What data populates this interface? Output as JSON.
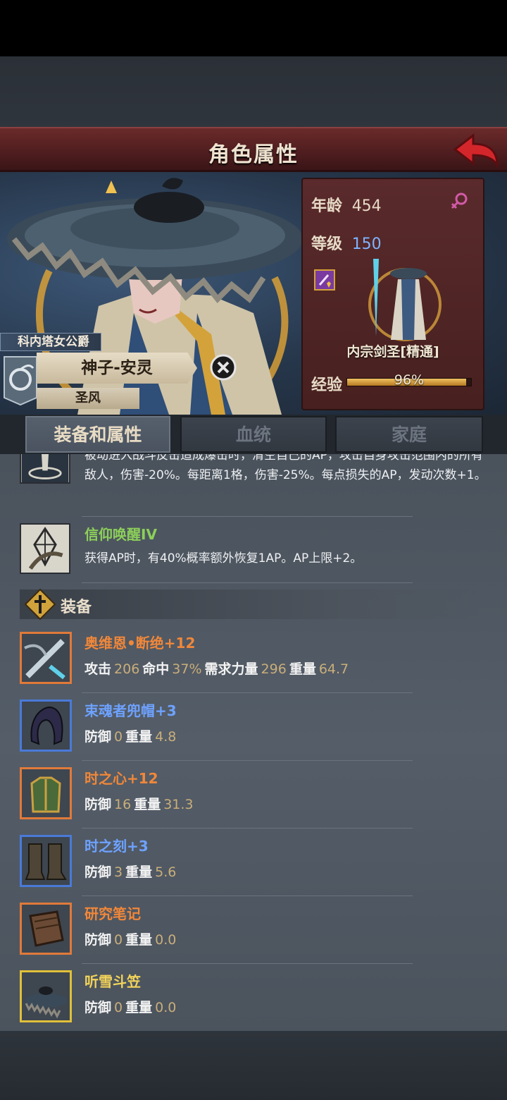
{
  "header": {
    "title": "角色属性",
    "back_icon": "red-back-arrow-icon"
  },
  "character": {
    "rank_title": "科内塔女公爵",
    "name": "神子-安灵",
    "sub_title": "圣风"
  },
  "stats": {
    "age_label": "年龄",
    "age_value": "454",
    "level_label": "等级",
    "level_value": "150",
    "class_name": "内宗剑圣[精通]",
    "exp_label": "经验",
    "exp_value": "96%",
    "exp_fraction": 0.96
  },
  "tabs": [
    {
      "label": "装备和属性",
      "active": true
    },
    {
      "label": "血统",
      "active": false
    },
    {
      "label": "家庭",
      "active": false
    }
  ],
  "skills": [
    {
      "name": "",
      "desc": "被动进入战斗反击造成爆击时，清空自己的AP，攻击自身攻击范围内的所有敌人，伤害-20%。每距离1格，伤害-25%。每点损失的AP，发动次数+1。"
    },
    {
      "name": "信仰唤醒IV",
      "desc": "获得AP时，有40%概率额外恢复1AP。AP上限+2。"
    }
  ],
  "equipment_section": {
    "title": "装备"
  },
  "equipment": [
    {
      "name": "奥维恩•断绝",
      "plus": "+12",
      "color": "#f0873a",
      "stats": [
        [
          "攻击",
          "206"
        ],
        [
          "命中",
          "37%"
        ],
        [
          "需求力量",
          "296"
        ],
        [
          "重量",
          "64.7"
        ]
      ]
    },
    {
      "name": "束魂者兜帽",
      "plus": "+3",
      "color": "#6ea2ff",
      "stats": [
        [
          "防御",
          "0"
        ],
        [
          "重量",
          "4.8"
        ]
      ]
    },
    {
      "name": "时之心",
      "plus": "+12",
      "color": "#f0873a",
      "stats": [
        [
          "防御",
          "16"
        ],
        [
          "重量",
          "31.3"
        ]
      ]
    },
    {
      "name": "时之刻",
      "plus": "+3",
      "color": "#6ea2ff",
      "stats": [
        [
          "防御",
          "3"
        ],
        [
          "重量",
          "5.6"
        ]
      ]
    },
    {
      "name": "研究笔记",
      "plus": "",
      "color": "#f0873a",
      "stats": [
        [
          "防御",
          "0"
        ],
        [
          "重量",
          "0.0"
        ]
      ]
    },
    {
      "name": "听雪斗笠",
      "plus": "",
      "color": "#f2d35a",
      "stats": [
        [
          "防御",
          "0"
        ],
        [
          "重量",
          "0.0"
        ]
      ]
    }
  ]
}
